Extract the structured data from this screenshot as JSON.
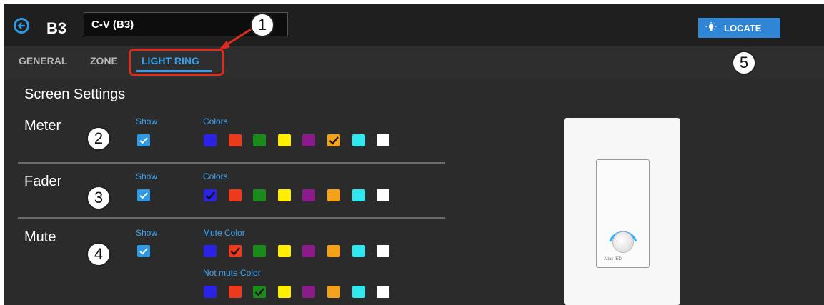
{
  "header": {
    "title": "B3",
    "name_value": "C-V (B3)",
    "locate_label": "LOCATE"
  },
  "tabs": [
    {
      "label": "GENERAL",
      "active": false
    },
    {
      "label": "ZONE",
      "active": false
    },
    {
      "label": "LIGHT RING",
      "active": true
    }
  ],
  "settings": {
    "section_title": "Screen Settings",
    "show_label": "Show",
    "colors_label": "Colors",
    "mute_color_label": "Mute Color",
    "not_mute_color_label": "Not mute Color",
    "rows": [
      {
        "label": "Meter",
        "show": true,
        "selected_index": 5
      },
      {
        "label": "Fader",
        "show": true,
        "selected_index": 0
      },
      {
        "label": "Mute",
        "show": true,
        "mute_selected_index": 1,
        "not_mute_selected_index": 2
      }
    ]
  },
  "palette": [
    "#2a23e6",
    "#ee3a1c",
    "#1a8a1a",
    "#ffee00",
    "#8b1a8b",
    "#f4a21a",
    "#2ee8ee",
    "#ffffff"
  ],
  "callouts": [
    "1",
    "2",
    "3",
    "4",
    "5"
  ],
  "preview": {
    "logo_text": "Atlas IED"
  },
  "icons": {
    "back": "back-arrow-circle-icon",
    "locate": "light-bulb-icon",
    "check": "check-icon"
  },
  "colors": {
    "accent": "#36a0f0",
    "callout_red": "#e02b1c",
    "background": "#2b2b2b"
  }
}
